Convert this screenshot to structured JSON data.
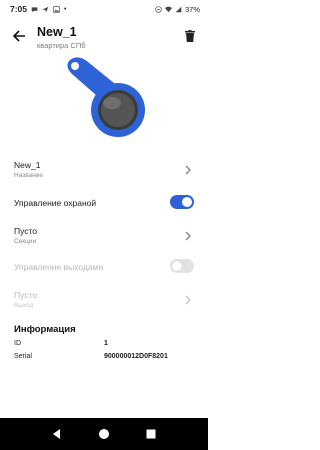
{
  "status_bar": {
    "time": "7:05",
    "battery": "37%"
  },
  "header": {
    "title": "New_1",
    "subtitle": "квартира СПб"
  },
  "rows": {
    "name": {
      "value": "New_1",
      "caption": "Название"
    },
    "security": {
      "label": "Управление охраной",
      "enabled": true
    },
    "sections": {
      "value": "Пусто",
      "caption": "Секции"
    },
    "outputs": {
      "label": "Управление выходами",
      "enabled": false
    },
    "exit": {
      "value": "Пусто",
      "caption": "Выход"
    }
  },
  "info": {
    "heading": "Информация",
    "id_label": "ID",
    "id_value": "1",
    "serial_label": "Serial",
    "serial_value": "900000012D0F8201"
  },
  "colors": {
    "accent": "#2f5fd9",
    "key_body": "#2e63d8",
    "key_disc": "#4a4a4a"
  }
}
